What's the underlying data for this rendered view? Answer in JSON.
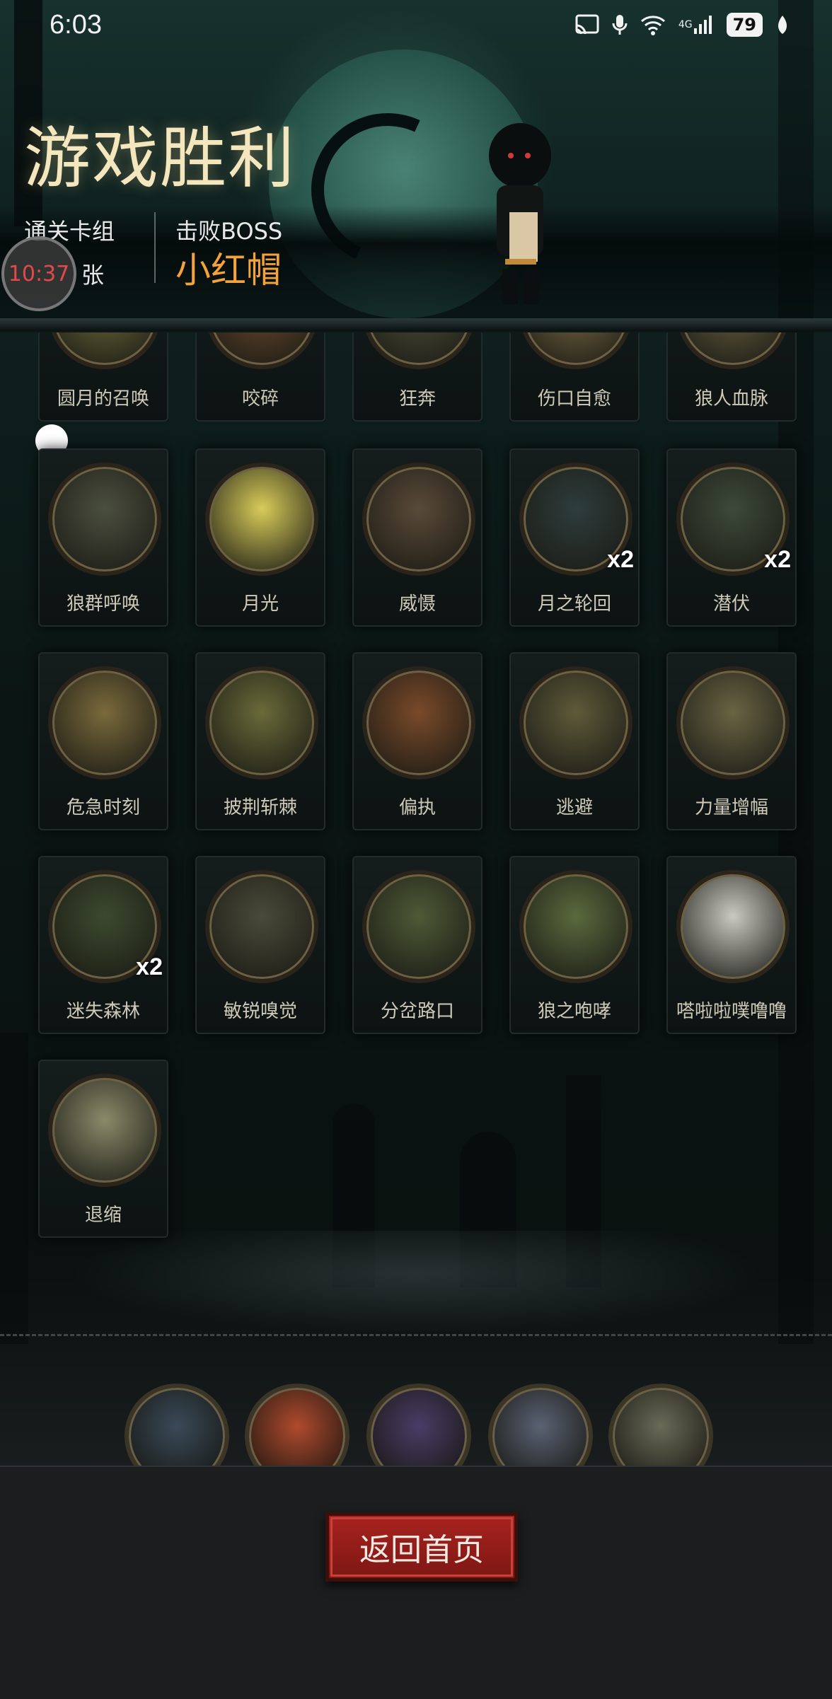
{
  "status_bar": {
    "time": "6:03",
    "network": "4G",
    "battery": "79",
    "icons": [
      "cast-icon",
      "mic-icon",
      "wifi-icon",
      "signal-icon",
      "battery-icon",
      "leaf-icon"
    ]
  },
  "header": {
    "title": "游戏胜利",
    "deck_label": "通关卡组",
    "deck_count_unit": "张",
    "timer": "10:37",
    "boss_label": "击败BOSS",
    "boss_name": "小红帽"
  },
  "cards": [
    {
      "label": "圆月的召唤",
      "art_color": "#6e6a3a"
    },
    {
      "label": "咬碎",
      "art_color": "#6b4a2e"
    },
    {
      "label": "狂奔",
      "art_color": "#4e4f3a"
    },
    {
      "label": "伤口自愈",
      "art_color": "#7b6a45"
    },
    {
      "label": "狼人血脉",
      "art_color": "#6a6040"
    },
    {
      "label": "狼群呼唤",
      "art_color": "#4b4f3f"
    },
    {
      "label": "月光",
      "art_color": "#d8cc5a"
    },
    {
      "label": "威慑",
      "art_color": "#5a4a38"
    },
    {
      "label": "月之轮回",
      "art_color": "#2e3d3c",
      "multiplier": "x2"
    },
    {
      "label": "潜伏",
      "art_color": "#3d4a3a",
      "multiplier": "x2"
    },
    {
      "label": "危急时刻",
      "art_color": "#7a6a3c"
    },
    {
      "label": "披荆斩棘",
      "art_color": "#6a6a3a"
    },
    {
      "label": "偏执",
      "art_color": "#7a4a2a"
    },
    {
      "label": "逃避",
      "art_color": "#5f5a3a"
    },
    {
      "label": "力量增幅",
      "art_color": "#6a6444"
    },
    {
      "label": "迷失森林",
      "art_color": "#3c4a2e",
      "multiplier": "x2"
    },
    {
      "label": "敏锐嗅觉",
      "art_color": "#4a4a3a"
    },
    {
      "label": "分岔路口",
      "art_color": "#4e5a36"
    },
    {
      "label": "狼之咆哮",
      "art_color": "#5a6a3e"
    },
    {
      "label": "嗒啦啦噗噜噜",
      "art_color": "#c9c9c2"
    },
    {
      "label": "退缩",
      "art_color": "#8a8a6a"
    }
  ],
  "tokens": [
    {
      "name": "werewolf-token",
      "color": "#3a4a58"
    },
    {
      "name": "skull-token",
      "color": "#b04a2e"
    },
    {
      "name": "spellbook-token",
      "color": "#4a3d66"
    },
    {
      "name": "knight-token",
      "color": "#5a6272"
    },
    {
      "name": "zombie-token",
      "color": "#6a6a58"
    }
  ],
  "footer": {
    "home_button_label": "返回首页"
  }
}
